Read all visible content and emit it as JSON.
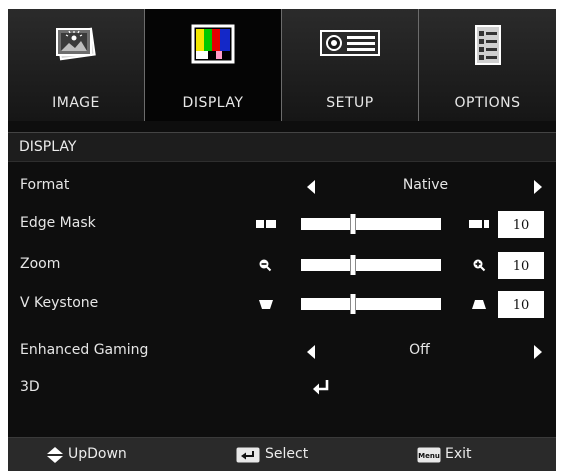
{
  "tabs": [
    {
      "label": "IMAGE",
      "icon": "image-icon",
      "active": false
    },
    {
      "label": "DISPLAY",
      "icon": "color-bars-icon",
      "active": true
    },
    {
      "label": "SETUP",
      "icon": "projector-icon",
      "active": false
    },
    {
      "label": "OPTIONS",
      "icon": "checklist-icon",
      "active": false
    }
  ],
  "section": {
    "title": "DISPLAY"
  },
  "rows": {
    "format": {
      "label": "Format",
      "value": "Native"
    },
    "edge_mask": {
      "label": "Edge Mask",
      "value": "10",
      "level_fraction": 0.35
    },
    "zoom": {
      "label": "Zoom",
      "value": "10",
      "level_fraction": 0.35
    },
    "v_keystone": {
      "label": "V Keystone",
      "value": "10",
      "level_fraction": 0.35
    },
    "enhanced_gaming": {
      "label": "Enhanced Gaming",
      "value": "Off"
    },
    "three_d": {
      "label": "3D",
      "icon": "enter-icon"
    }
  },
  "footer": {
    "updown_label": "UpDown",
    "select_label": "Select",
    "exit_label": "Exit",
    "menu_key_label": "Menu"
  },
  "colors": {
    "background": "#0e0e0e",
    "tab_bar": "#1c1c1c",
    "footer": "#2a2a2a",
    "text": "#e6e6e6",
    "slider": "#ffffff"
  }
}
